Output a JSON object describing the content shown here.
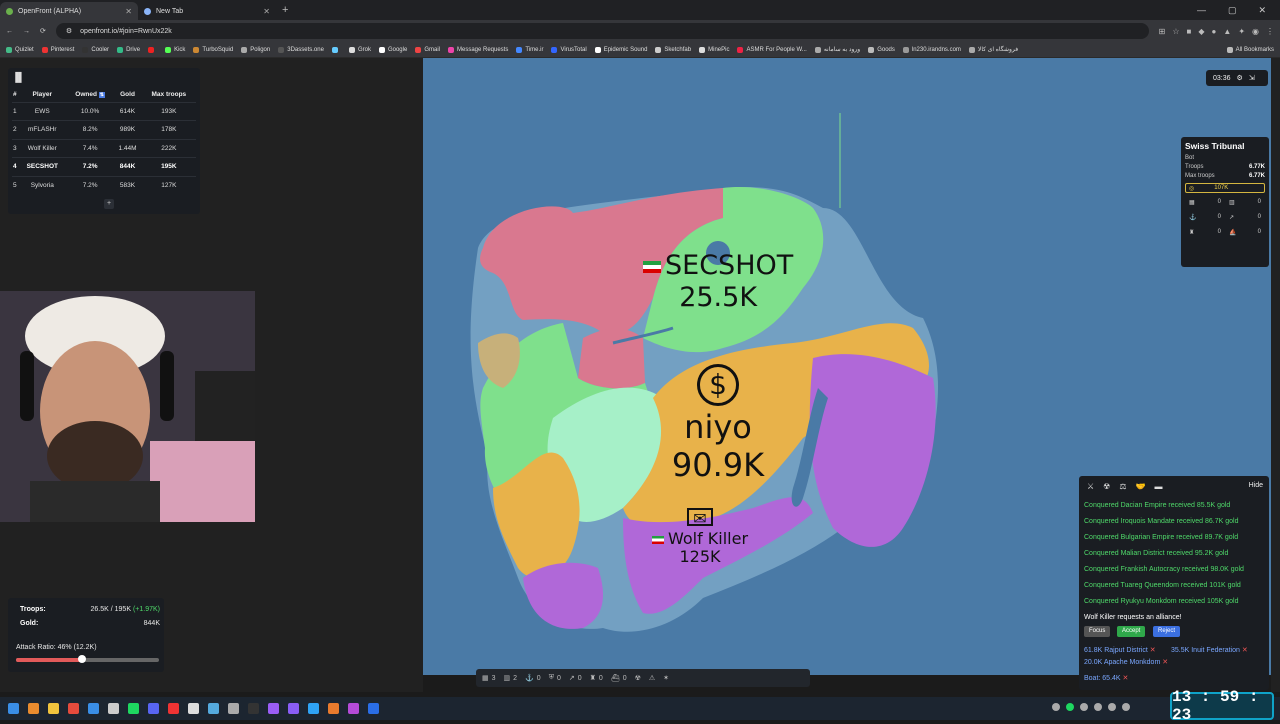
{
  "browser": {
    "tabs": [
      {
        "title": "OpenFront (ALPHA)",
        "active": true
      },
      {
        "title": "New Tab",
        "active": false
      }
    ],
    "url": "openfront.io/#join=RwnUx22k",
    "bookmarks": [
      "Quizlet",
      "Pinterest",
      "Cooler",
      "Drive",
      "",
      "Kick",
      "TurboSquid",
      "Poligon",
      "3Dassets.one",
      "",
      "Grok",
      "Google",
      "Gmail",
      "Message Requests",
      "Time.ir",
      "VirusTotal",
      "Epidemic Sound",
      "Sketchfab",
      "MinePic",
      "ASMR For People W...",
      "ورود به سامانه",
      "Goods",
      "ln230.irandns.com",
      "فروشگاه ای کالا"
    ],
    "all_bookmarks": "All Bookmarks"
  },
  "leaderboard": {
    "headers": [
      "#",
      "Player",
      "Owned",
      "Gold",
      "Max troops"
    ],
    "rows": [
      {
        "rank": "1",
        "player": "EWS",
        "owned": "10.0%",
        "gold": "614K",
        "max": "193K",
        "me": false
      },
      {
        "rank": "2",
        "player": "mFLASHr",
        "owned": "8.2%",
        "gold": "989K",
        "max": "178K",
        "me": false
      },
      {
        "rank": "3",
        "player": "Wolf Killer",
        "owned": "7.4%",
        "gold": "1.44M",
        "max": "222K",
        "me": false
      },
      {
        "rank": "4",
        "player": "SECSHOT",
        "owned": "7.2%",
        "gold": "844K",
        "max": "195K",
        "me": true
      },
      {
        "rank": "5",
        "player": "Sylvoria",
        "owned": "7.2%",
        "gold": "583K",
        "max": "127K",
        "me": false
      }
    ],
    "expand": "+"
  },
  "stats": {
    "troops_label": "Troops:",
    "troops_value": "26.5K / 195K",
    "troops_delta": "(+1.97K)",
    "gold_label": "Gold:",
    "gold_value": "844K",
    "attack_ratio_label": "Attack Ratio: 46% (12.2K)",
    "attack_ratio": 0.46
  },
  "timer": {
    "time": "03:36"
  },
  "info_panel": {
    "name": "Swiss Tribunal",
    "type": "Bot",
    "troops_label": "Troops",
    "troops": "6.77K",
    "max_troops_label": "Max troops",
    "max_troops": "6.77K",
    "gold": "107K",
    "buildings": [
      "0",
      "0",
      "0",
      "0",
      "0",
      "0"
    ]
  },
  "map": {
    "labels": [
      {
        "name": "SECSHOT",
        "value": "25.5K"
      },
      {
        "name": "niyo",
        "value": "90.9K"
      },
      {
        "name": "Wolf Killer",
        "value": "125K"
      }
    ]
  },
  "events": {
    "hide": "Hide",
    "messages": [
      "Conquered Dacian Empire received 85.5K gold",
      "Conquered Iroquois Mandate received 86.7K gold",
      "Conquered Bulgarian Empire received 89.7K gold",
      "Conquered Malian District received 95.2K gold",
      "Conquered Frankish Autocracy received 98.0K gold",
      "Conquered Tuareg Queendom received 101K gold",
      "Conquered Ryukyu Monkdom received 105K gold"
    ],
    "alliance_request": "Wolf Killer requests an alliance!",
    "focus": "Focus",
    "accept": "Accept",
    "reject": "Reject",
    "attacks": [
      "61.8K Rajput District",
      "35.5K Inuit Federation",
      "20.0K Apache Monkdom",
      "Boat: 65.4K"
    ]
  },
  "toolbar": {
    "counts": [
      "3",
      "2",
      "0",
      "0",
      "0",
      "0",
      "0"
    ]
  },
  "clock": {
    "time": "13 : 59 : 23"
  }
}
